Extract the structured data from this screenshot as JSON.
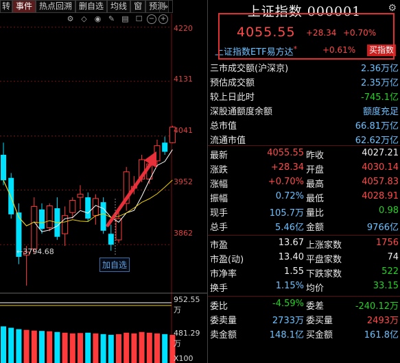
{
  "tabs": {
    "items": [
      {
        "label": "转",
        "active": false
      },
      {
        "label": "事件",
        "active": true
      },
      {
        "label": "热点回溯",
        "active": false
      },
      {
        "label": "删自选",
        "active": false
      },
      {
        "label": "均线",
        "active": false
      },
      {
        "label": "窗",
        "active": false
      },
      {
        "label": "预测",
        "active": false
      }
    ],
    "more_icon": "chevron-double-right-icon"
  },
  "toolbar": {
    "icons": [
      "settings-icon",
      "diamond-icon",
      "eye-icon",
      "pencil-icon",
      "print-icon",
      "square-icon",
      "zoom-out-icon",
      "zoom-in-icon"
    ]
  },
  "chart": {
    "y_ticks": [
      "4220",
      "4131",
      "4041",
      "3952",
      "3862"
    ],
    "vol_ticks": [
      "952.55万",
      "481.29万"
    ],
    "vol_unit": "X100",
    "low_annotation": "3794.68",
    "add_favorite_label": "加自选",
    "colors": {
      "up": "#ff3b3b",
      "down": "#00e0ff",
      "ma5": "#ffffff",
      "ma10": "#f0d000",
      "arrow": "#e8303a",
      "grid": "#7a1010"
    }
  },
  "chart_data": {
    "type": "candlestick",
    "ylim": [
      3780,
      4240
    ],
    "y_ticks": [
      4220,
      4131,
      4041,
      3952,
      3862
    ],
    "candles": [
      {
        "o": 4010,
        "h": 4030,
        "l": 3960,
        "c": 3968
      },
      {
        "o": 3972,
        "h": 3980,
        "l": 3905,
        "c": 3912
      },
      {
        "o": 3915,
        "h": 3930,
        "l": 3830,
        "c": 3842
      },
      {
        "o": 3845,
        "h": 3860,
        "l": 3794.68,
        "c": 3850
      },
      {
        "o": 3855,
        "h": 3940,
        "l": 3848,
        "c": 3925
      },
      {
        "o": 3920,
        "h": 3930,
        "l": 3880,
        "c": 3888
      },
      {
        "o": 3890,
        "h": 3930,
        "l": 3884,
        "c": 3926
      },
      {
        "o": 3922,
        "h": 3940,
        "l": 3870,
        "c": 3875
      },
      {
        "o": 3880,
        "h": 3925,
        "l": 3860,
        "c": 3910
      },
      {
        "o": 3915,
        "h": 3940,
        "l": 3905,
        "c": 3935
      },
      {
        "o": 3940,
        "h": 3960,
        "l": 3920,
        "c": 3945
      },
      {
        "o": 3940,
        "h": 3948,
        "l": 3900,
        "c": 3905
      },
      {
        "o": 3910,
        "h": 3945,
        "l": 3895,
        "c": 3938
      },
      {
        "o": 3932,
        "h": 3940,
        "l": 3880,
        "c": 3885
      },
      {
        "o": 3880,
        "h": 3895,
        "l": 3852,
        "c": 3862
      },
      {
        "o": 3870,
        "h": 3915,
        "l": 3865,
        "c": 3905
      },
      {
        "o": 3930,
        "h": 3990,
        "l": 3918,
        "c": 3982
      },
      {
        "o": 3955,
        "h": 3975,
        "l": 3945,
        "c": 3958
      },
      {
        "o": 3970,
        "h": 4010,
        "l": 3965,
        "c": 4002
      },
      {
        "o": 3970,
        "h": 3998,
        "l": 3962,
        "c": 3995
      },
      {
        "o": 4000,
        "h": 4035,
        "l": 3990,
        "c": 4025
      },
      {
        "o": 4030,
        "h": 4040,
        "l": 4010,
        "c": 4015
      },
      {
        "o": 4030,
        "h": 4057.83,
        "l": 4028.91,
        "c": 4055.55
      }
    ],
    "volumes": [
      520,
      500,
      480,
      470,
      460,
      455,
      450,
      440,
      430,
      420,
      425,
      430,
      420,
      410,
      400,
      410,
      430,
      420,
      440,
      430,
      420,
      410,
      400
    ],
    "vol_max": 952.55
  },
  "quote": {
    "title": "上证指数 000001",
    "settings_icon": "gear-icon",
    "price": "4055.55",
    "change": "+28.34",
    "change_pct": "+0.70%",
    "etf_name": "上证指数ETF易方达",
    "etf_marker": "*",
    "etf_pct": "+0.61%",
    "etf_buy_label": "买指数",
    "stats": [
      {
        "label": "三市成交额(沪深京)",
        "value": "2.36万亿",
        "color": "cyan"
      },
      {
        "label": "预估成交额",
        "value": "2.35万亿",
        "color": "cyan"
      },
      {
        "label": "较上日此时",
        "value": "-745.1亿",
        "color": "green"
      },
      {
        "label": "深股通额度余额",
        "value": "额度充足",
        "color": "cyan"
      },
      {
        "label": "总市值",
        "value": "66.81万亿",
        "color": "cyan"
      },
      {
        "label": "流通市值",
        "value": "62.62万亿",
        "color": "cyan"
      }
    ],
    "pairs1": [
      {
        "l1": "最新",
        "v1": "4055.55",
        "c1": "red",
        "l2": "昨收",
        "v2": "4027.21",
        "c2": "white"
      },
      {
        "l1": "涨跌",
        "v1": "+28.34",
        "c1": "red",
        "l2": "开盘",
        "v2": "4030.14",
        "c2": "red"
      },
      {
        "l1": "涨幅",
        "v1": "+0.70%",
        "c1": "red",
        "l2": "最高",
        "v2": "4057.83",
        "c2": "red"
      },
      {
        "l1": "振幅",
        "v1": "0.72%",
        "c1": "cyan",
        "l2": "最低",
        "v2": "4028.91",
        "c2": "red"
      },
      {
        "l1": "现手",
        "v1": "105.7万",
        "c1": "cyan",
        "l2": "量比",
        "v2": "0.98",
        "c2": "green"
      },
      {
        "l1": "总手",
        "v1": "5.46亿",
        "c1": "cyan",
        "l2": "金额",
        "v2": "9766亿",
        "c2": "cyan"
      }
    ],
    "pairs2": [
      {
        "l1": "市盈",
        "v1": "13.67",
        "c1": "white",
        "l2": "上涨家数",
        "v2": "1756",
        "c2": "red"
      },
      {
        "l1": "市盈(动)",
        "v1": "13.40",
        "c1": "white",
        "l2": "平盘家数",
        "v2": "74",
        "c2": "white"
      },
      {
        "l1": "市净率",
        "v1": "1.55",
        "c1": "white",
        "l2": "下跌家数",
        "v2": "522",
        "c2": "green"
      },
      {
        "l1": "换手",
        "v1": "1.15%",
        "c1": "cyan",
        "l2": "均价",
        "v2": "33.15",
        "c2": "green"
      }
    ],
    "pairs3": [
      {
        "l1": "委比",
        "v1": "-4.59%",
        "c1": "green",
        "l2": "委差",
        "v2": "-240.12万",
        "c2": "green"
      },
      {
        "l1": "委卖量",
        "v1": "2733万",
        "c1": "cyan",
        "l2": "委买量",
        "v2": "2493万",
        "c2": "red"
      },
      {
        "l1": "卖金额",
        "v1": "148.1亿",
        "c1": "cyan",
        "l2": "买金额",
        "v2": "161.8亿",
        "c2": "cyan"
      }
    ]
  }
}
